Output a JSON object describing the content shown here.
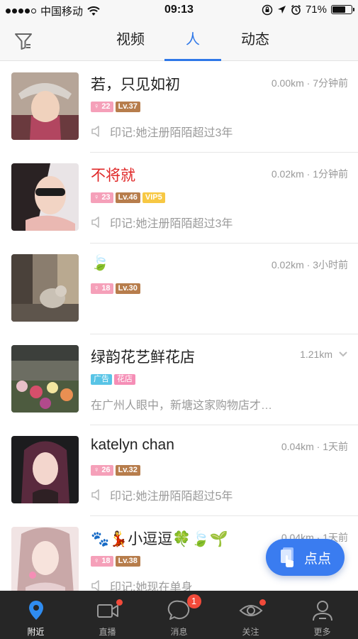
{
  "status_bar": {
    "carrier": "中国移动",
    "time": "09:13",
    "battery_percent": "71%",
    "battery_level": 0.71
  },
  "nav": {
    "filter_icon": "filter-icon",
    "tabs": [
      {
        "label": "视频",
        "active": false
      },
      {
        "label": "人",
        "active": true
      },
      {
        "label": "动态",
        "active": false
      }
    ]
  },
  "people": [
    {
      "name": "若，只见如初",
      "distance": "0.00km · 7分钟前",
      "age": "22",
      "level": "Lv.37",
      "note": "印记:她注册陌陌超过3年"
    },
    {
      "name": "不将就",
      "distance": "0.02km · 1分钟前",
      "age": "23",
      "level": "Lv.46",
      "vip": "VIP5",
      "note": "印记:她注册陌陌超过3年"
    },
    {
      "name": "🍃",
      "distance": "0.02km · 3小时前",
      "age": "18",
      "level": "Lv.30",
      "note": ""
    },
    {
      "name": "绿韵花艺鲜花店",
      "distance": "1.21km",
      "tag_ad": "广告",
      "tag_shop": "花店",
      "note": "在广州人眼中，新塘这家购物店才…"
    },
    {
      "name": "katelyn chan",
      "distance": "0.04km · 1天前",
      "age": "26",
      "level": "Lv.32",
      "note": "印记:她注册陌陌超过5年"
    },
    {
      "name": "🐾💃小逗逗🍀🍃🌱",
      "distance": "0.04km · 1天前",
      "age": "18",
      "level": "Lv.38",
      "note": "印记:她现在单身"
    }
  ],
  "fab": {
    "label": "点点"
  },
  "tab_bar": {
    "items": [
      {
        "label": "附近",
        "icon": "location-pin-icon",
        "active": true
      },
      {
        "label": "直播",
        "icon": "video-camera-icon",
        "dot": true
      },
      {
        "label": "消息",
        "icon": "chat-bubble-icon",
        "count": "1"
      },
      {
        "label": "关注",
        "icon": "eye-icon",
        "dot": true
      },
      {
        "label": "更多",
        "icon": "person-icon"
      }
    ]
  },
  "colors": {
    "accent": "#2f78e8",
    "vip_name": "#e02727",
    "tab_bar_bg": "#262626",
    "badge_red": "#f24a3a"
  }
}
